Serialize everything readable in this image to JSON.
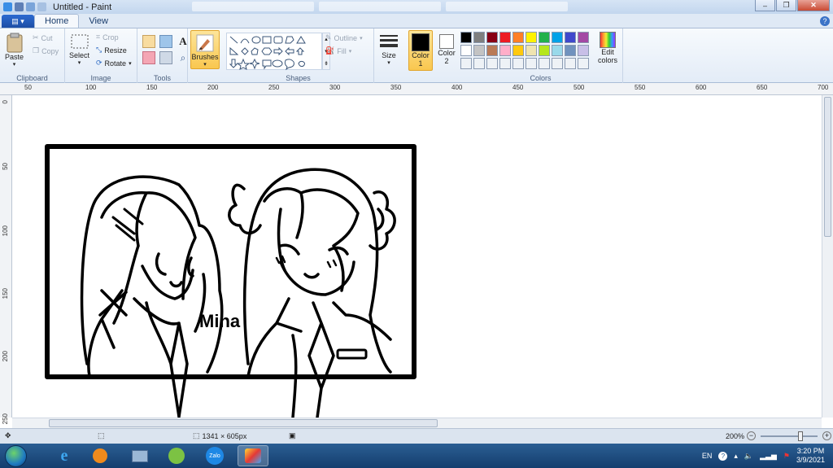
{
  "window": {
    "title": "Untitled - Paint",
    "min_symbol": "–",
    "max_symbol": "❐",
    "close_symbol": "✕"
  },
  "tabs": [
    {
      "label": "Home",
      "active": true
    },
    {
      "label": "View",
      "active": false
    }
  ],
  "help_symbol": "?",
  "ribbon": {
    "clipboard": {
      "label": "Clipboard",
      "paste": "Paste",
      "cut": "Cut",
      "copy": "Copy"
    },
    "image": {
      "label": "Image",
      "select": "Select",
      "crop": "Crop",
      "resize": "Resize",
      "rotate": "Rotate"
    },
    "tools": {
      "label": "Tools"
    },
    "brushes": {
      "label": "Brushes"
    },
    "shapes": {
      "label": "Shapes",
      "outline": "Outline",
      "fill": "Fill"
    },
    "size": {
      "label": "Size"
    },
    "color1": {
      "label": "Color",
      "num": "1",
      "value": "#000000"
    },
    "color2": {
      "label": "Color",
      "num": "2",
      "value": "#ffffff"
    },
    "colors": {
      "label": "Colors"
    },
    "edit_colors": {
      "line1": "Edit",
      "line2": "colors"
    }
  },
  "palette_row1": [
    "#000000",
    "#7f7f7f",
    "#880015",
    "#ed1c24",
    "#ff7f27",
    "#fff200",
    "#22b14c",
    "#00a2e8",
    "#3f48cc",
    "#a349a4"
  ],
  "palette_row2": [
    "#ffffff",
    "#c3c3c3",
    "#b97a57",
    "#ffaec9",
    "#ffc90e",
    "#efe4b0",
    "#b5e61d",
    "#99d9ea",
    "#7092be",
    "#c8bfe7"
  ],
  "ruler_h": [
    "50",
    "100",
    "150",
    "200",
    "250",
    "300",
    "350",
    "400",
    "450",
    "500",
    "550",
    "600",
    "650",
    "700"
  ],
  "ruler_v": [
    "0",
    "50",
    "100",
    "150",
    "200",
    "250"
  ],
  "canvas_text": "Mina",
  "status": {
    "image_size": "1341 × 605px",
    "zoom": "200%"
  },
  "taskbar": {
    "zalo_label": "Zalo",
    "lang": "EN",
    "time": "3:20 PM",
    "date": "3/9/2021"
  }
}
